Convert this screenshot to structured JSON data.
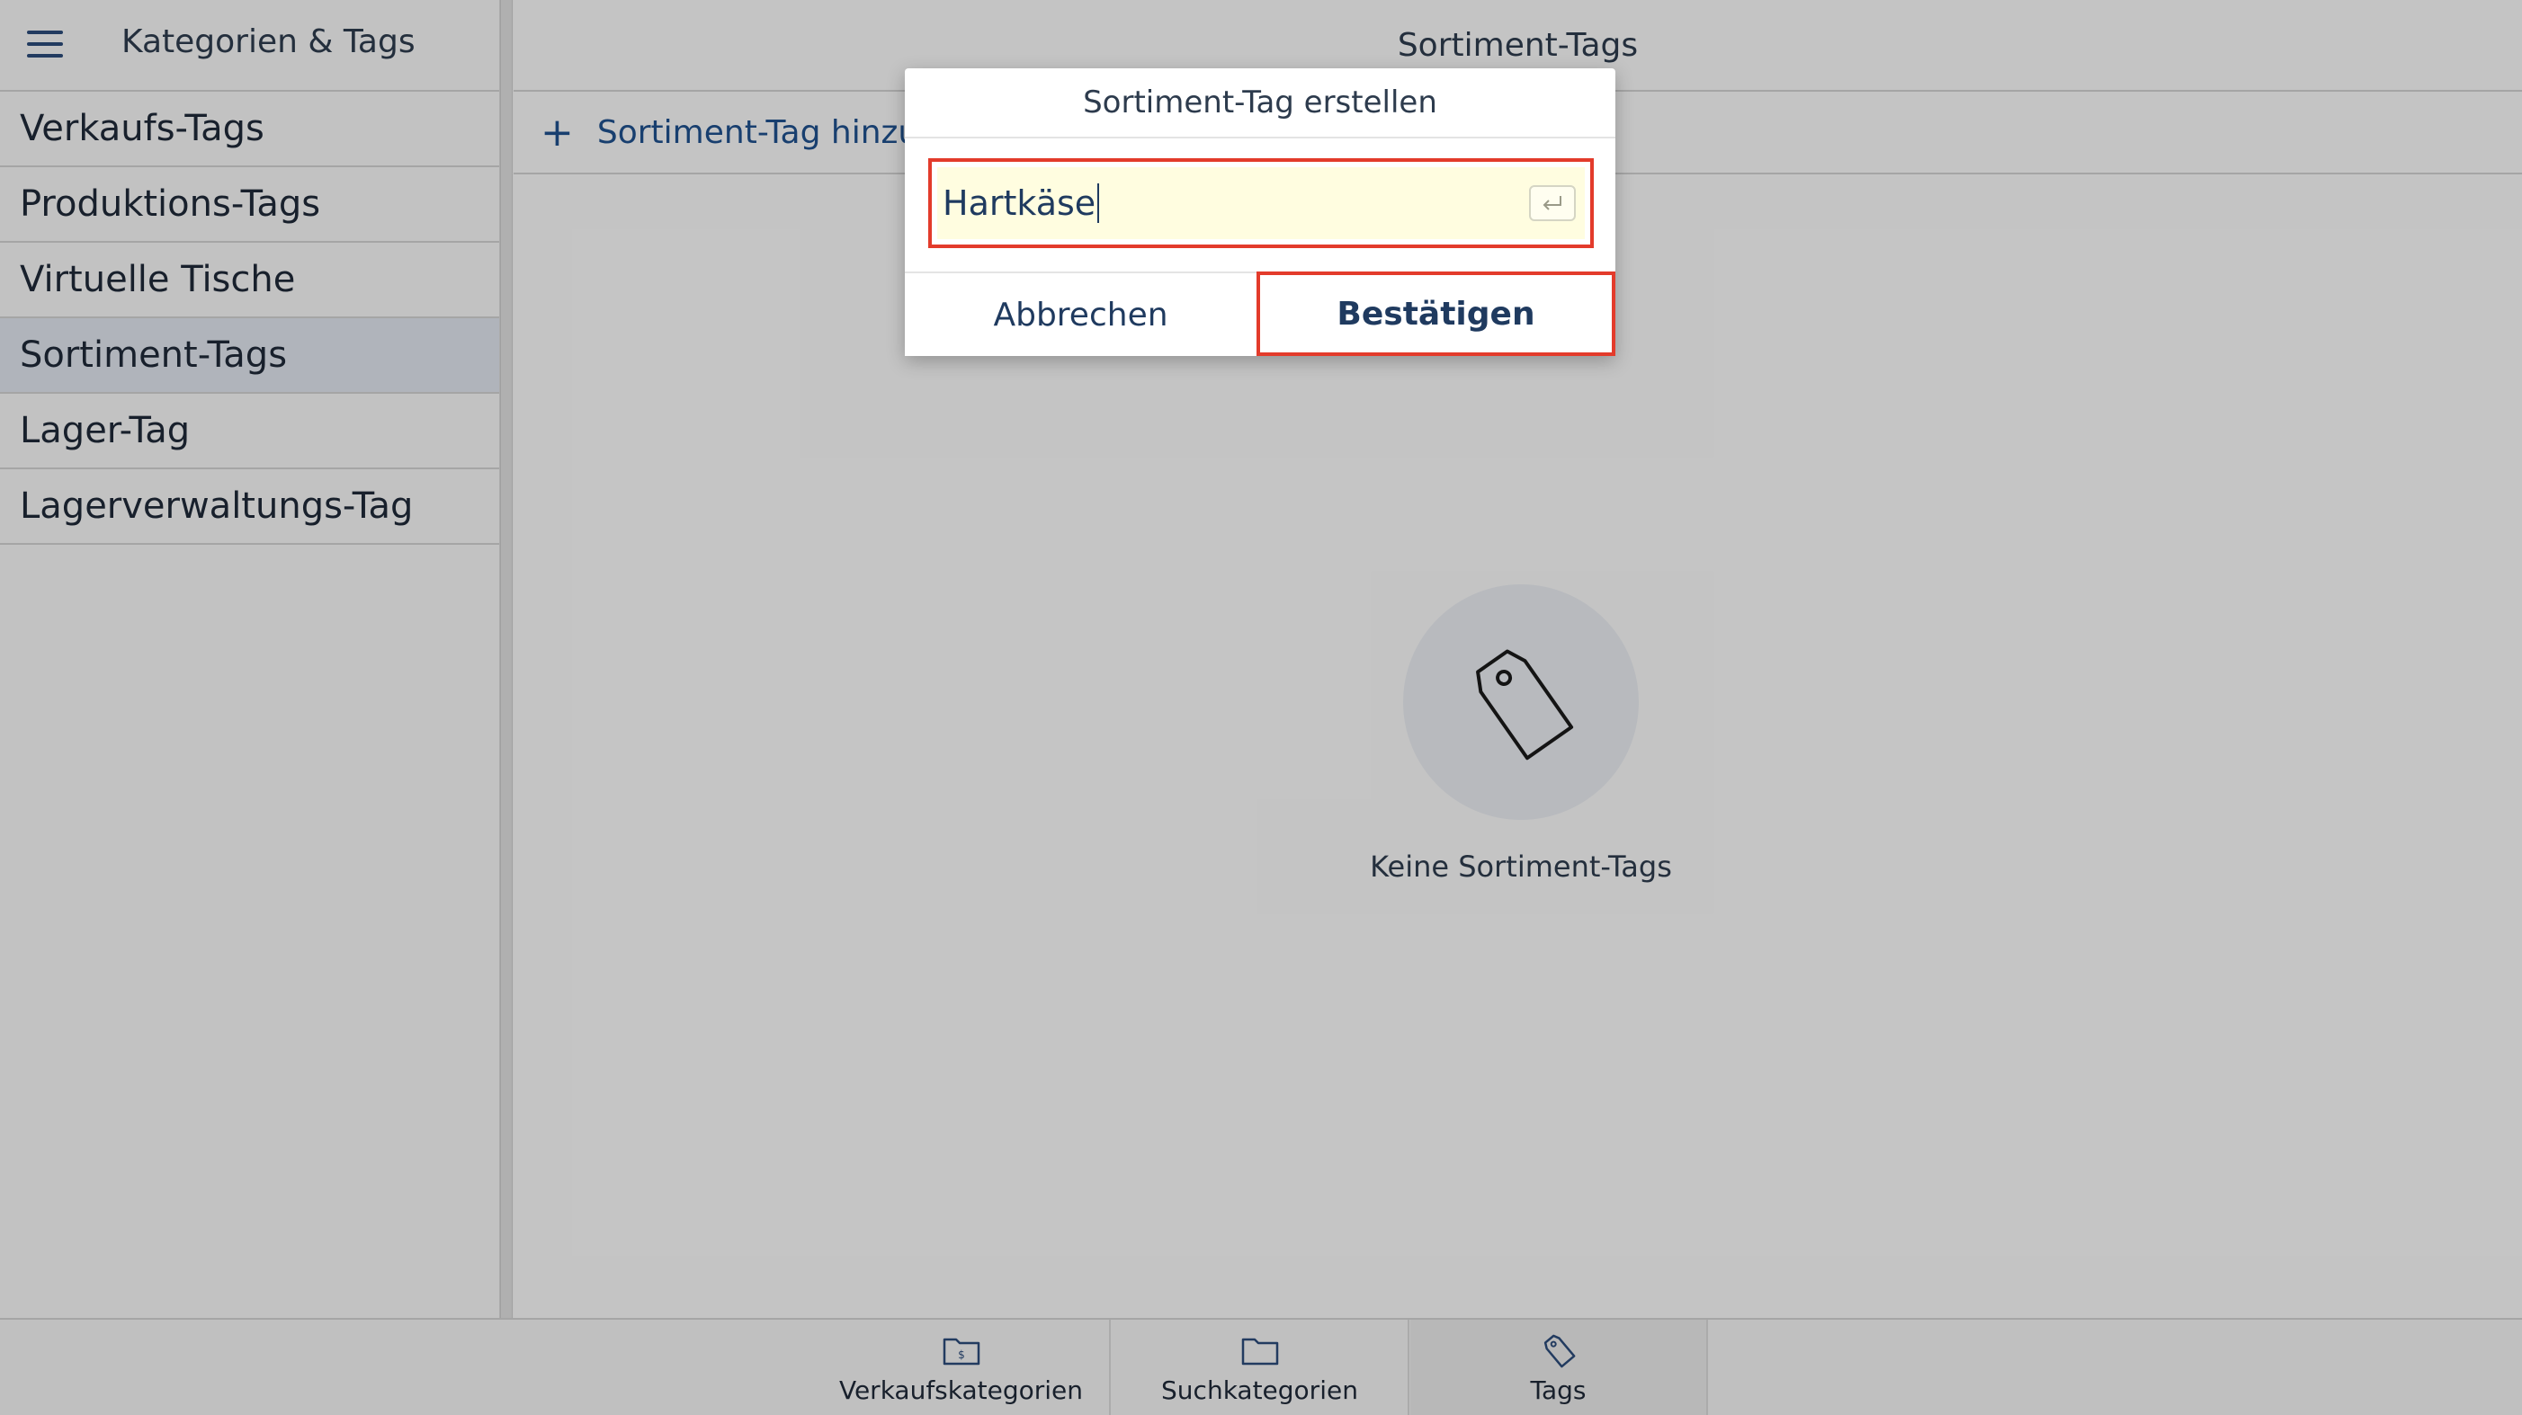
{
  "sidebar": {
    "title": "Kategorien & Tags",
    "items": [
      {
        "label": "Verkaufs-Tags"
      },
      {
        "label": "Produktions-Tags"
      },
      {
        "label": "Virtuelle Tische"
      },
      {
        "label": "Sortiment-Tags"
      },
      {
        "label": "Lager-Tag"
      },
      {
        "label": "Lagerverwaltungs-Tag"
      }
    ],
    "active_index": 3
  },
  "main": {
    "title": "Sortiment-Tags",
    "add_label": "Sortiment-Tag hinzufü",
    "empty_text": "Keine Sortiment-Tags"
  },
  "dialog": {
    "title": "Sortiment-Tag erstellen",
    "input_value": "Hartkäse",
    "cancel_label": "Abbrechen",
    "confirm_label": "Bestätigen"
  },
  "bottom_tabs": [
    {
      "label": "Verkaufskategorien",
      "icon": "sales-folder-icon"
    },
    {
      "label": "Suchkategorien",
      "icon": "folder-icon"
    },
    {
      "label": "Tags",
      "icon": "tag-icon"
    }
  ],
  "colors": {
    "accent": "#1f4f8b",
    "highlight_border": "#e33b2b",
    "input_background": "#fffde0"
  }
}
